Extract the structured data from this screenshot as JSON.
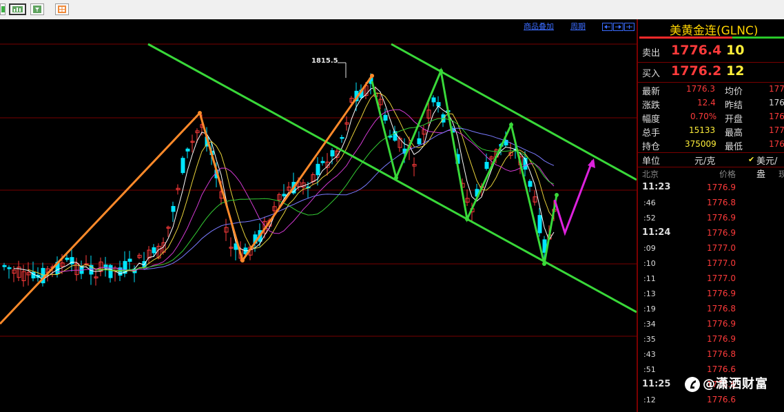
{
  "toolbar": {
    "icons": [
      "green-square-icon",
      "bar-chart-icon",
      "filter-icon",
      "grid-icon"
    ]
  },
  "chart": {
    "link_overlay": "商品叠加",
    "link_period": "周期",
    "peak_label": "1815.5",
    "colors": {
      "up": "#ff3b3b",
      "down": "#00e6ff",
      "channel": "#39d839",
      "trend_orange": "#ff8a2a",
      "forecast": "#dd22dd",
      "grid": "#7a0000"
    }
  },
  "quote": {
    "title": "美黄金连(GLNC)",
    "sell_label": "卖出",
    "sell_price": "1776.4",
    "sell_qty": "10",
    "buy_label": "买入",
    "buy_price": "1776.2",
    "buy_qty": "12",
    "latest_label": "最新",
    "latest_value": "1776.3",
    "avg_label": "均价",
    "avg_value": "177",
    "change_label": "涨跌",
    "change_value": "12.4",
    "prev_close_label": "昨结",
    "prev_close_value": "176",
    "range_label": "幅度",
    "range_value": "0.70%",
    "open_label": "开盘",
    "open_value": "176",
    "volume_label": "总手",
    "volume_value": "15133",
    "high_label": "最高",
    "high_value": "177",
    "position_label": "持仓",
    "position_value": "375009",
    "low_label": "最低",
    "low_value": "176",
    "unit_label": "单位",
    "unit_value": "元/克",
    "unit_alt": "美元/盎",
    "city_label": "北京",
    "price_col": "价格",
    "vol_col_partial": "现"
  },
  "ticks": [
    {
      "time": "11:23",
      "price": "1776.9",
      "hour": true
    },
    {
      "time": ":46",
      "price": "1776.8",
      "hour": false
    },
    {
      "time": ":52",
      "price": "1776.9",
      "hour": false
    },
    {
      "time": "11:24",
      "price": "1776.9",
      "hour": true
    },
    {
      "time": ":09",
      "price": "1777.0",
      "hour": false
    },
    {
      "time": ":10",
      "price": "1777.0",
      "hour": false
    },
    {
      "time": ":11",
      "price": "1777.0",
      "hour": false
    },
    {
      "time": ":13",
      "price": "1776.9",
      "hour": false
    },
    {
      "time": ":19",
      "price": "1776.8",
      "hour": false
    },
    {
      "time": ":34",
      "price": "1776.9",
      "hour": false
    },
    {
      "time": ":35",
      "price": "1776.9",
      "hour": false
    },
    {
      "time": ":43",
      "price": "1776.8",
      "hour": false
    },
    {
      "time": ":51",
      "price": "1776.6",
      "hour": false
    },
    {
      "time": "11:25",
      "price": "1776.6",
      "hour": true
    },
    {
      "time": ":12",
      "price": "1776.6",
      "hour": false
    }
  ],
  "watermark": "@潇洒财富"
}
